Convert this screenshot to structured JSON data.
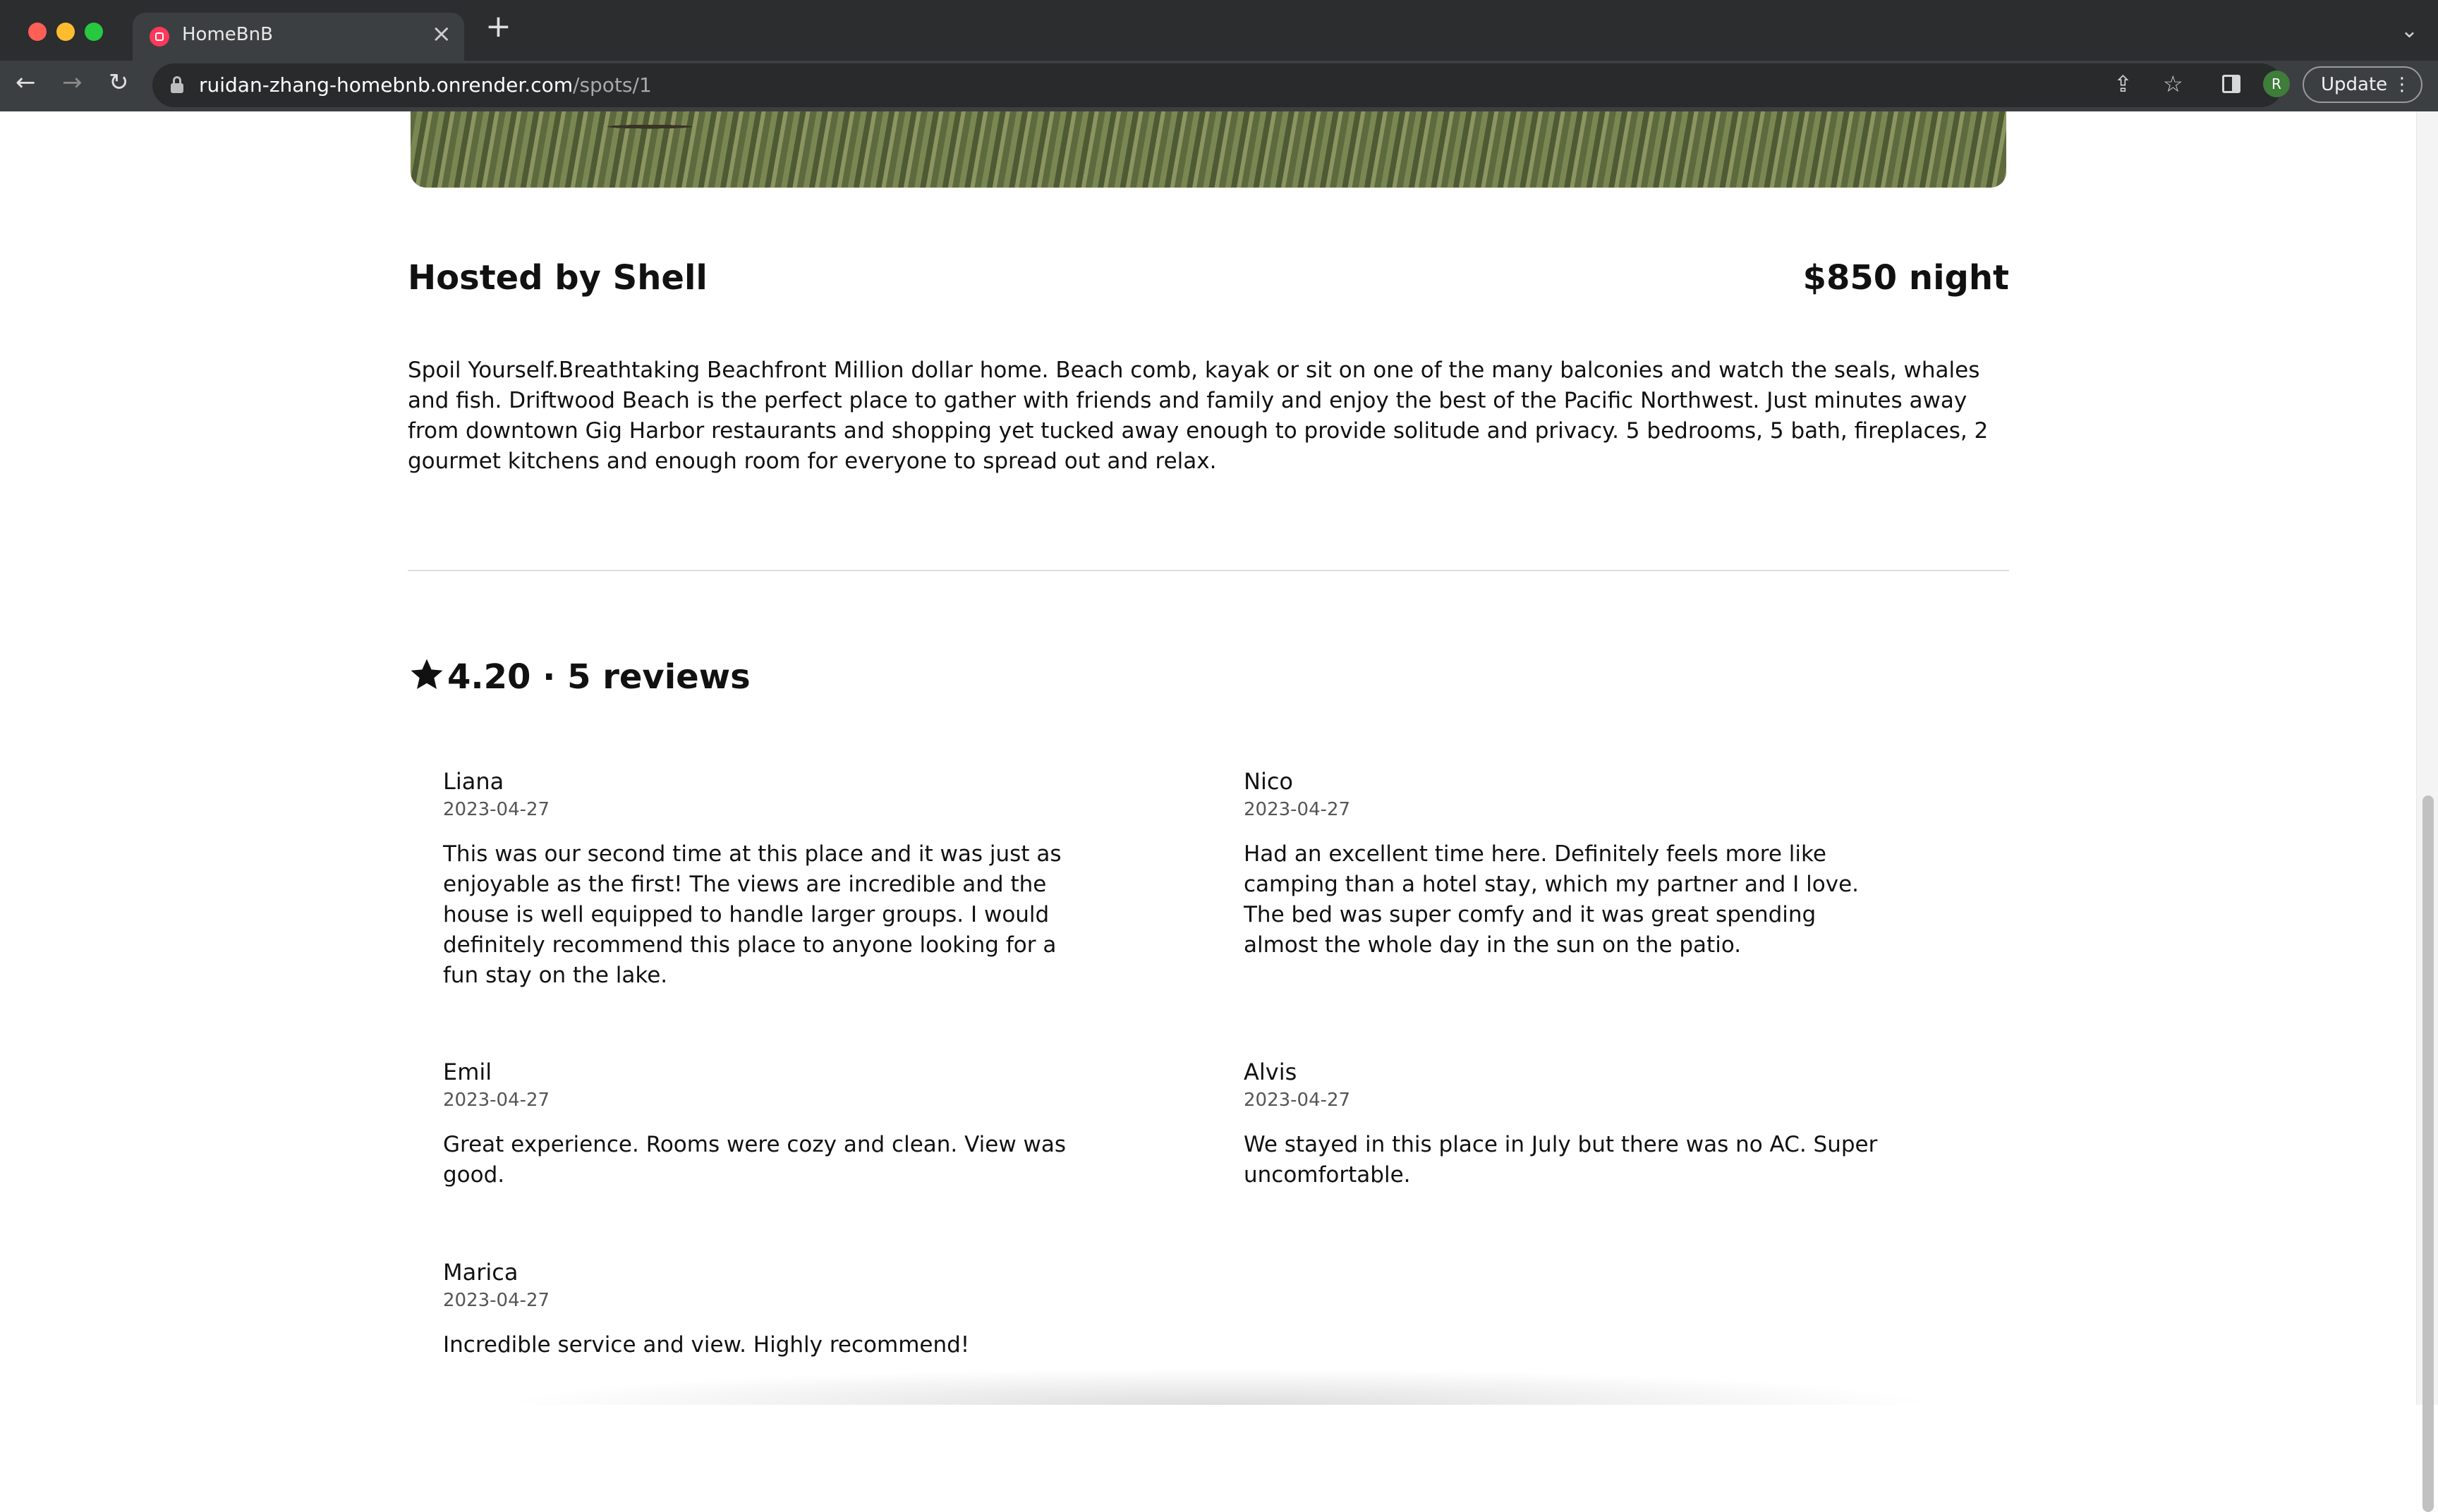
{
  "browser": {
    "tab_title": "HomeBnB",
    "url_host": "ruidan-zhang-homebnb.onrender.com",
    "url_path": "/spots/1",
    "profile_initial": "R",
    "update_label": "Update"
  },
  "spot": {
    "host_title": "Hosted by Shell",
    "price": "$850 night",
    "description": "Spoil Yourself.Breathtaking Beachfront Million dollar home. Beach comb, kayak or sit on one of the many balconies and watch the seals, whales and fish. Driftwood Beach is the perfect place to gather with friends and family and enjoy the best of the Pacific Northwest. Just minutes away from downtown Gig Harbor restaurants and shopping yet tucked away enough to provide solitude and privacy. 5 bedrooms, 5 bath, fireplaces, 2 gourmet kitchens and enough room for everyone to spread out and relax."
  },
  "rating_summary": "4.20 · 5 reviews",
  "reviews": [
    {
      "name": "Liana",
      "date": "2023-04-27",
      "text": "This was our second time at this place and it was just as enjoyable as the first! The views are incredible and the house is well equipped to handle larger groups. I would definitely recommend this place to anyone looking for a fun stay on the lake."
    },
    {
      "name": "Nico",
      "date": "2023-04-27",
      "text": "Had an excellent time here. Definitely feels more like camping than a hotel stay, which my partner and I love. The bed was super comfy and it was great spending almost the whole day in the sun on the patio."
    },
    {
      "name": "Emil",
      "date": "2023-04-27",
      "text": "Great experience. Rooms were cozy and clean. View was good."
    },
    {
      "name": "Alvis",
      "date": "2023-04-27",
      "text": "We stayed in this place in July but there was no AC. Super uncomfortable."
    },
    {
      "name": "Marica",
      "date": "2023-04-27",
      "text": "Incredible service and view. Highly recommend!"
    }
  ]
}
